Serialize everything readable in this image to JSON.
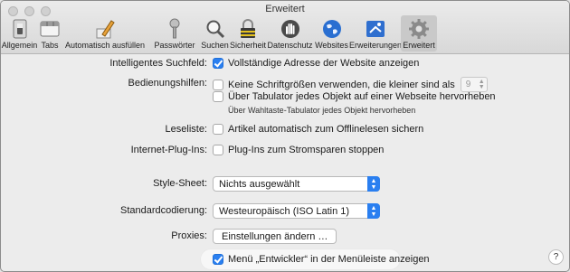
{
  "window": {
    "title": "Erweitert"
  },
  "toolbar": {
    "items": [
      {
        "label": "Allgemein",
        "icon": "switch-icon"
      },
      {
        "label": "Tabs",
        "icon": "tabs-icon"
      },
      {
        "label": "Automatisch ausfüllen",
        "icon": "pencil-icon"
      },
      {
        "label": "Passwörter",
        "icon": "key-icon"
      },
      {
        "label": "Suchen",
        "icon": "magnifier-icon"
      },
      {
        "label": "Sicherheit",
        "icon": "lock-icon"
      },
      {
        "label": "Datenschutz",
        "icon": "hand-icon"
      },
      {
        "label": "Websites",
        "icon": "globe-icon"
      },
      {
        "label": "Erweiterungen",
        "icon": "puzzle-icon"
      },
      {
        "label": "Erweitert",
        "icon": "gear-icon",
        "active": true
      }
    ]
  },
  "settings": {
    "smart_search": {
      "label": "Intelligentes Suchfeld:",
      "option": "Vollständige Adresse der Website anzeigen",
      "checked": true
    },
    "accessibility": {
      "label": "Bedienungshilfen:",
      "min_font_option": "Keine Schriftgrößen verwenden, die kleiner sind als",
      "min_font_value": "9",
      "tab_option": "Über Tabulator jedes Objekt auf einer Webseite hervorheben",
      "tab_hint": "Über Wahltaste-Tabulator jedes Objekt hervorheben"
    },
    "reading_list": {
      "label": "Leseliste:",
      "option": "Artikel automatisch zum Offlinelesen sichern"
    },
    "plugins": {
      "label": "Internet-Plug-Ins:",
      "option": "Plug-Ins zum Stromsparen stoppen"
    },
    "style_sheet": {
      "label": "Style-Sheet:",
      "value": "Nichts ausgewählt"
    },
    "encoding": {
      "label": "Standardcodierung:",
      "value": "Westeuropäisch (ISO Latin 1)"
    },
    "proxies": {
      "label": "Proxies:",
      "button": "Einstellungen ändern …"
    },
    "develop_menu": {
      "option": "Menü „Entwickler“ in der Menüleiste anzeigen",
      "checked": true
    }
  },
  "help": {
    "label": "?"
  },
  "colors": {
    "accent": "#2a7ff0"
  }
}
